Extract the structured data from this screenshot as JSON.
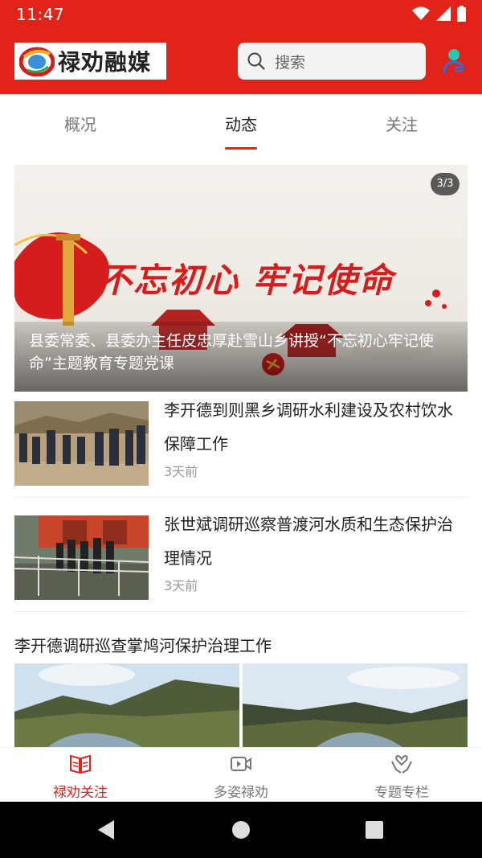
{
  "status_bar": {
    "time": "11:47"
  },
  "header": {
    "logo_text": "禄劝融媒",
    "search_placeholder": "搜索"
  },
  "tabs": [
    {
      "label": "概况",
      "active": false
    },
    {
      "label": "动态",
      "active": true
    },
    {
      "label": "关注",
      "active": false
    }
  ],
  "banner": {
    "counter": "3/3",
    "slogan": "不忘初心 牢记使命",
    "caption": "县委常委、县委办主任皮忠厚赴雪山乡讲授“不忘初心牢记使命”主题教育专题党课"
  },
  "news": [
    {
      "title": "李开德到则黑乡调研水利建设及农村饮水保障工作",
      "time": "3天前"
    },
    {
      "title": "张世斌调研巡察普渡河水质和生态保护治理情况",
      "time": "3天前"
    }
  ],
  "gallery": {
    "title": "李开德调研巡查掌鸠河保护治理工作"
  },
  "bottom_nav": [
    {
      "label": "禄劝关注",
      "icon": "book-icon",
      "active": true
    },
    {
      "label": "多姿禄劝",
      "icon": "video-icon",
      "active": false
    },
    {
      "label": "专题专栏",
      "icon": "hands-icon",
      "active": false
    }
  ],
  "colors": {
    "brand_red": "#e2231a",
    "text": "#222222",
    "muted": "#999999"
  }
}
